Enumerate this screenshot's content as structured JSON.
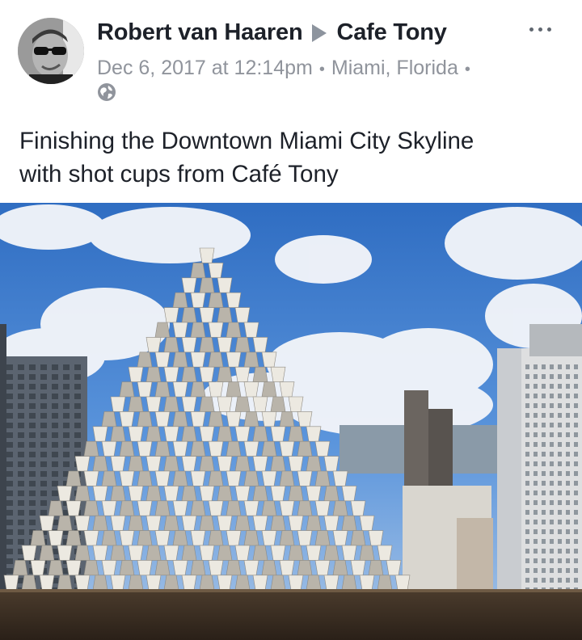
{
  "post": {
    "author": "Robert van Haaren",
    "target_page": "Cafe Tony",
    "timestamp": "Dec 6, 2017 at 12:14pm",
    "location": "Miami, Florida",
    "separator": "•",
    "privacy_icon": "globe-icon",
    "more_icon": "more-options-icon",
    "message_line1": "Finishing the Downtown Miami City Skyline",
    "message_line2": "with shot cups from Café Tony"
  },
  "colors": {
    "name_text": "#1d2129",
    "meta_text": "#90949c",
    "sky": "#3f7fcf",
    "cup": "#e6e3da"
  }
}
